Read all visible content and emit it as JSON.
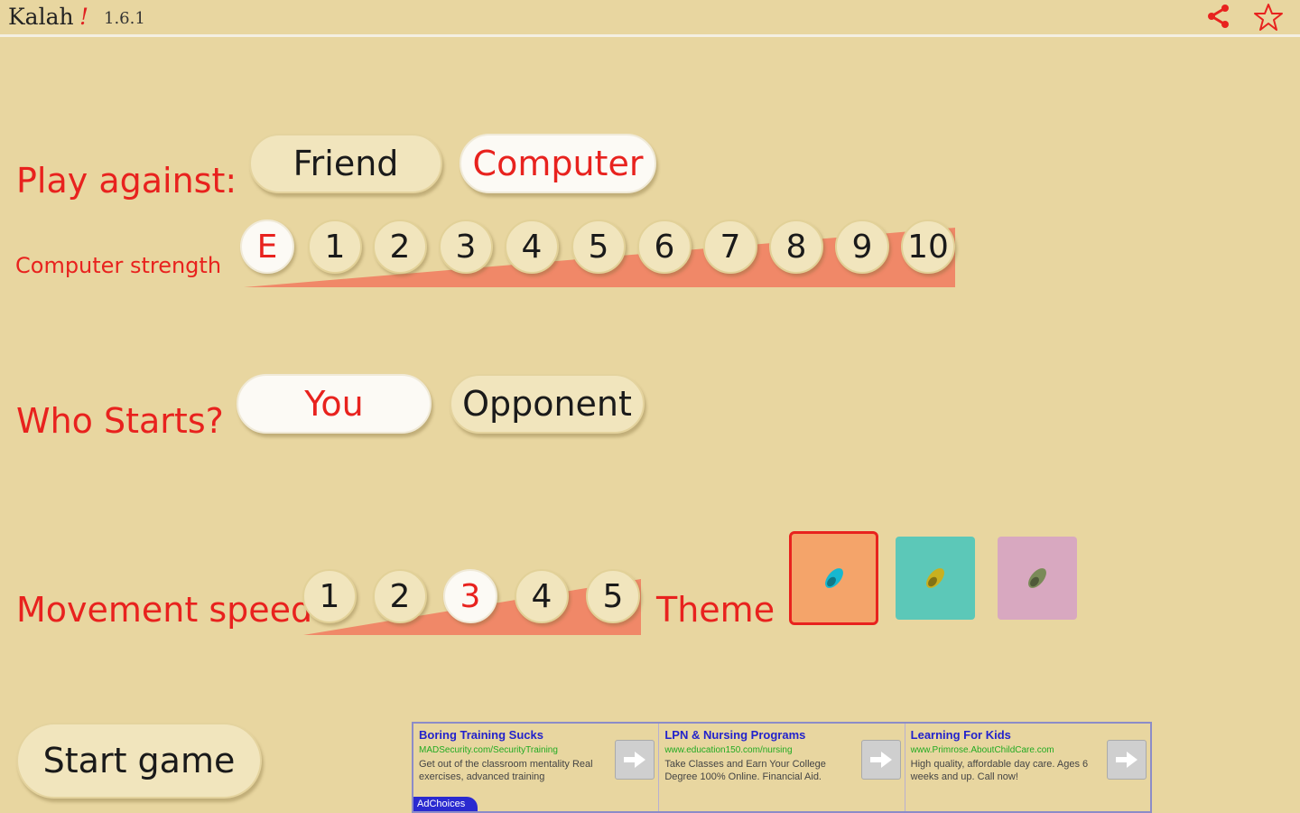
{
  "header": {
    "title": "Kalah",
    "bang": "!",
    "version": "1.6.1"
  },
  "play_against": {
    "label": "Play against:",
    "options": [
      "Friend",
      "Computer"
    ],
    "selected": "Computer"
  },
  "computer_strength": {
    "label": "Computer strength",
    "levels": [
      "E",
      "1",
      "2",
      "3",
      "4",
      "5",
      "6",
      "7",
      "8",
      "9",
      "10"
    ],
    "selected": "E"
  },
  "who_starts": {
    "label": "Who Starts?",
    "options": [
      "You",
      "Opponent"
    ],
    "selected": "You"
  },
  "movement_speed": {
    "label": "Movement speed",
    "levels": [
      "1",
      "2",
      "3",
      "4",
      "5"
    ],
    "selected": "3"
  },
  "theme": {
    "label": "Theme",
    "options": [
      {
        "name": "theme-orange",
        "bg": "#f4a46a",
        "seed": "#17b8d0"
      },
      {
        "name": "theme-teal",
        "bg": "#5cc8b8",
        "seed": "#c8b020"
      },
      {
        "name": "theme-pink",
        "bg": "#d8a8c0",
        "seed": "#7a8a58"
      }
    ],
    "selected_index": 0
  },
  "start_button": {
    "label": "Start game"
  },
  "colors": {
    "accent": "#e8221e",
    "background": "#e8d6a0",
    "ramp": "#f08868"
  },
  "ad": {
    "items": [
      {
        "title": "Boring Training Sucks",
        "url": "MADSecurity.com/SecurityTraining",
        "desc": "Get out of the classroom mentality Real exercises, advanced training"
      },
      {
        "title": "LPN & Nursing Programs",
        "url": "www.education150.com/nursing",
        "desc": "Take Classes and Earn Your College Degree 100% Online. Financial Aid."
      },
      {
        "title": "Learning For Kids",
        "url": "www.Primrose.AboutChildCare.com",
        "desc": "High quality, affordable day care. Ages 6 weeks and up. Call now!"
      }
    ],
    "adchoices": "AdChoices"
  }
}
